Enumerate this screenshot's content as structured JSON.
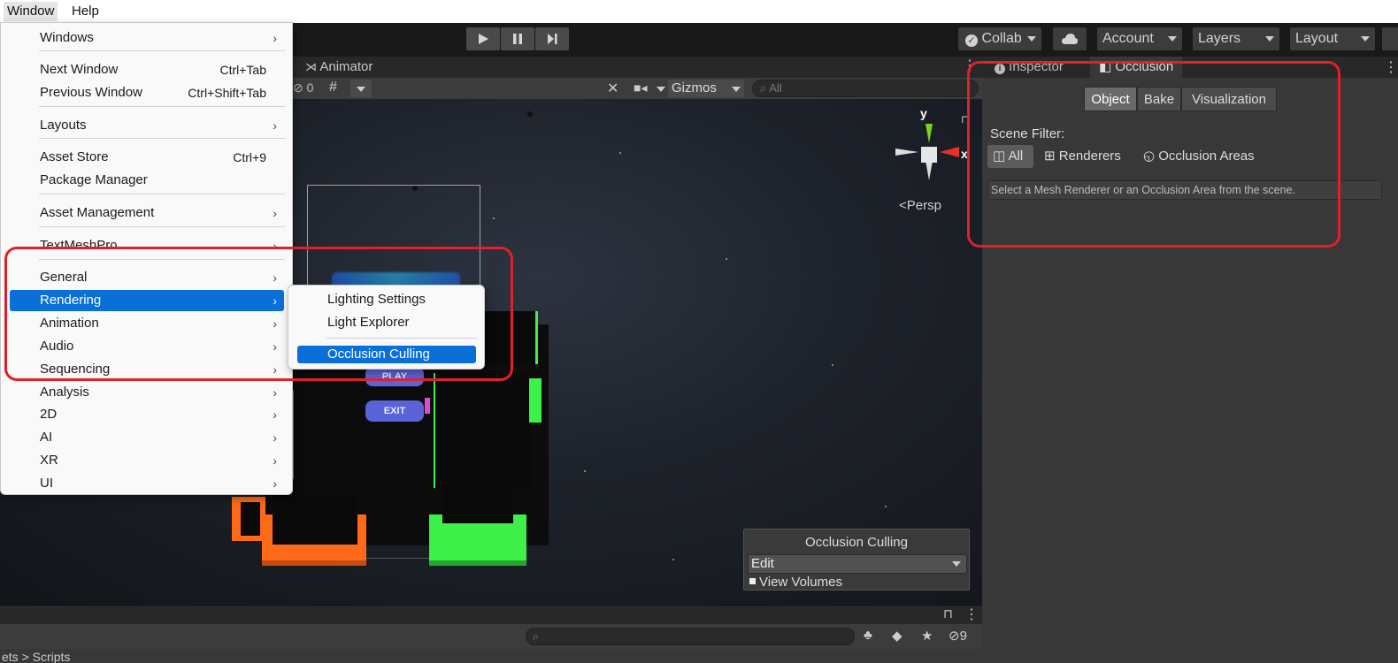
{
  "menubar": {
    "window": "Window",
    "help": "Help"
  },
  "toolbar": {
    "collab": "Collab",
    "account": "Account",
    "layers": "Layers",
    "layout": "Layout"
  },
  "scene": {
    "animator_tab": "Animator",
    "hidden_count": "0",
    "gizmos": "Gizmos",
    "search_placeholder": "All",
    "axis_y": "y",
    "axis_x": "x",
    "persp": "Persp",
    "play_label": "PLAY",
    "exit_label": "EXIT",
    "overlay": {
      "title": "Occlusion Culling",
      "mode": "Edit",
      "view_volumes": "View Volumes"
    }
  },
  "window_menu": {
    "items": [
      {
        "label": "Windows",
        "shortcut": "",
        "submenu": true
      },
      {
        "label": "Next Window",
        "shortcut": "Ctrl+Tab",
        "submenu": false
      },
      {
        "label": "Previous Window",
        "shortcut": "Ctrl+Shift+Tab",
        "submenu": false
      },
      {
        "label": "Layouts",
        "shortcut": "",
        "submenu": true
      },
      {
        "label": "Asset Store",
        "shortcut": "Ctrl+9",
        "submenu": false
      },
      {
        "label": "Package Manager",
        "shortcut": "",
        "submenu": false
      },
      {
        "label": "Asset Management",
        "shortcut": "",
        "submenu": true
      },
      {
        "label": "TextMeshPro",
        "shortcut": "",
        "submenu": true
      },
      {
        "label": "General",
        "shortcut": "",
        "submenu": true
      },
      {
        "label": "Rendering",
        "shortcut": "",
        "submenu": true
      },
      {
        "label": "Animation",
        "shortcut": "",
        "submenu": true
      },
      {
        "label": "Audio",
        "shortcut": "",
        "submenu": true
      },
      {
        "label": "Sequencing",
        "shortcut": "",
        "submenu": true
      },
      {
        "label": "Analysis",
        "shortcut": "",
        "submenu": true
      },
      {
        "label": "2D",
        "shortcut": "",
        "submenu": true
      },
      {
        "label": "AI",
        "shortcut": "",
        "submenu": true
      },
      {
        "label": "XR",
        "shortcut": "",
        "submenu": true
      },
      {
        "label": "UI",
        "shortcut": "",
        "submenu": true
      }
    ],
    "highlighted": "Rendering"
  },
  "rendering_submenu": {
    "items": [
      "Lighting Settings",
      "Light Explorer",
      "Occlusion Culling"
    ],
    "highlighted": "Occlusion Culling"
  },
  "inspector": {
    "tab_inspector": "Inspector",
    "tab_occlusion": "Occlusion",
    "segments": [
      "Object",
      "Bake",
      "Visualization"
    ],
    "active_segment": "Object",
    "scene_filter_label": "Scene Filter:",
    "filters": [
      "All",
      "Renderers",
      "Occlusion Areas"
    ],
    "active_filter": "All",
    "hint": "Select a Mesh Renderer or an Occlusion Area from the scene."
  },
  "bottom": {
    "hidden_count": "9",
    "breadcrumb": "ets > Scripts"
  },
  "colors": {
    "highlight": "#0a6fd6",
    "annotation_red": "#e0202a",
    "scene_green": "#3ef04a",
    "scene_orange": "#ff6a1a"
  }
}
